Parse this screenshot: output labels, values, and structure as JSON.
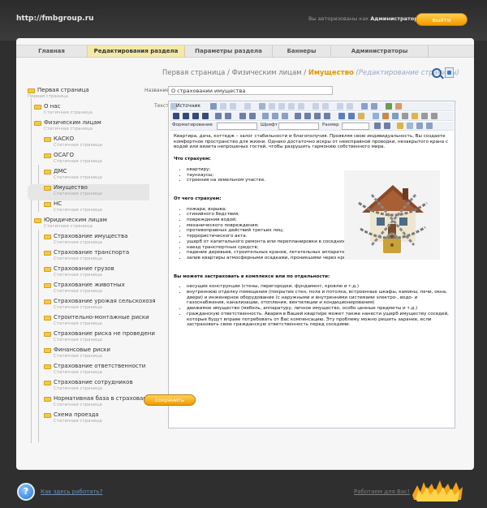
{
  "header": {
    "site_url": "http://fmbgroup.ru",
    "auth_text": "Вы авторизованы как ",
    "auth_user": "Администратор",
    "exit_label": "выйти"
  },
  "nav": {
    "tabs": [
      {
        "label": "Главная"
      },
      {
        "label": "Редактирования раздела"
      },
      {
        "label": "Параметры раздела"
      },
      {
        "label": "Баннеры"
      },
      {
        "label": "Администраторы"
      }
    ]
  },
  "breadcrumb": {
    "part1": "Первая страница",
    "part2": "Физическим лицам",
    "current": "Имущество",
    "note": "(Редактирование страницы)",
    "sep": " / "
  },
  "tree": [
    {
      "name": "Первая страница",
      "sub": "Первая страница"
    },
    {
      "name": "О нас",
      "sub": "Статичная страница"
    },
    {
      "name": "Физическим лицам",
      "sub": "Статичная страница"
    },
    {
      "name": "КАСКО",
      "sub": "Статичная страница"
    },
    {
      "name": "ОСАГО",
      "sub": "Статичная страница"
    },
    {
      "name": "ДМС",
      "sub": "Статичная страница"
    },
    {
      "name": "Имущество",
      "sub": "Статичная страница"
    },
    {
      "name": "НС",
      "sub": "Статичная страница"
    },
    {
      "name": "Юридическим лицам",
      "sub": "Статичная страница"
    },
    {
      "name": "Страхование имущества",
      "sub": "Статичная страница"
    },
    {
      "name": "Страхование транспорта",
      "sub": "Статичная страница"
    },
    {
      "name": "Страхование грузов",
      "sub": "Статичная страница"
    },
    {
      "name": "Страхование животных",
      "sub": "Статичная страница"
    },
    {
      "name": "Страхование урожая сельскохозя",
      "sub": "Статичная страница"
    },
    {
      "name": "Строительно-монтажные риски",
      "sub": "Статичная страница"
    },
    {
      "name": "Страхование риска не проведени",
      "sub": "Статичная страница"
    },
    {
      "name": "Финансовые риски",
      "sub": "Статичная страница"
    },
    {
      "name": "Страхование ответственности",
      "sub": "Статичная страница"
    },
    {
      "name": "Страхование сотрудников",
      "sub": "Статичная страница"
    },
    {
      "name": "Нормативная база в страховании",
      "sub": "Статичная страница"
    },
    {
      "name": "Схема проезда",
      "sub": "Статичная страница"
    }
  ],
  "form": {
    "title_label": "Название",
    "title_value": "О страховании имущества",
    "text_label": "Текст",
    "save_label": "сохранить"
  },
  "editor": {
    "source_label": "Источник",
    "format_label": "Форматирование",
    "font_label": "Шрифт",
    "size_label": "Размер"
  },
  "content": {
    "intro": "Квартира, дача, коттедж – залог стабильности и благополучия. Проявляя свою индивидуальность, Вы создаете комфортное пространство для жизни. Однако достаточно искры от неисправной проводки, незакрытого крана с водой или визита непрошеных гостей, чтобы разрушить гармонию собственного мира.",
    "h1": "Что страхуем:",
    "list1": [
      "квартиру;",
      "таунхаусы;",
      "строения на земельном участке."
    ],
    "h2": "От чего страхуем:",
    "list2": [
      "пожара; взрыва;",
      "стихийного бедствия;",
      "повреждения водой;",
      "механического повреждения;",
      "противоправных действий третьих лиц;",
      "террористического акта.",
      "ущерб от капитального ремонта или перепланировки в соседних квартирах;",
      "наезд транспортных средств;",
      "падение деревьев, строительных кранов, летательных аппаратов;",
      "залив квартиры атмосферными осадками, проникшими через крышу, чердак."
    ],
    "h3": "Вы можете застраховать в комплексе или по отдельности:",
    "list3": [
      "несущие конструкции (стены, перегородки, фундамент, кровлю и т.д.)",
      "внутреннюю отделку помещения (покрытие стен, пола и потолка, встроенные шкафы, камины, печи, окна, двери) и инженерное оборудование (с наружными и внутренними системами электро-, водо- и газоснабжения, канализации, отопления, вентиляции и кондиционирования)",
      "движимое имущество (мебель, аппаратуру, личное имущество, особо ценные предметы и т.д.)",
      "гражданскую ответственность. Авария в Вашей квартире может также нанести ущерб имуществу соседей, которые будут вправе потребовать от Вас компенсацию. Эту проблему можно решить заранее, если застраховать свою гражданскую ответственность перед соседями."
    ]
  },
  "footer": {
    "help_label": "Как здесь работать?",
    "works_label": "Работаем для Вас!",
    "help_symbol": "?"
  },
  "colors": {
    "accent": "#f2a100",
    "crumb_current": "#e79600",
    "link": "#6f8fb3"
  }
}
